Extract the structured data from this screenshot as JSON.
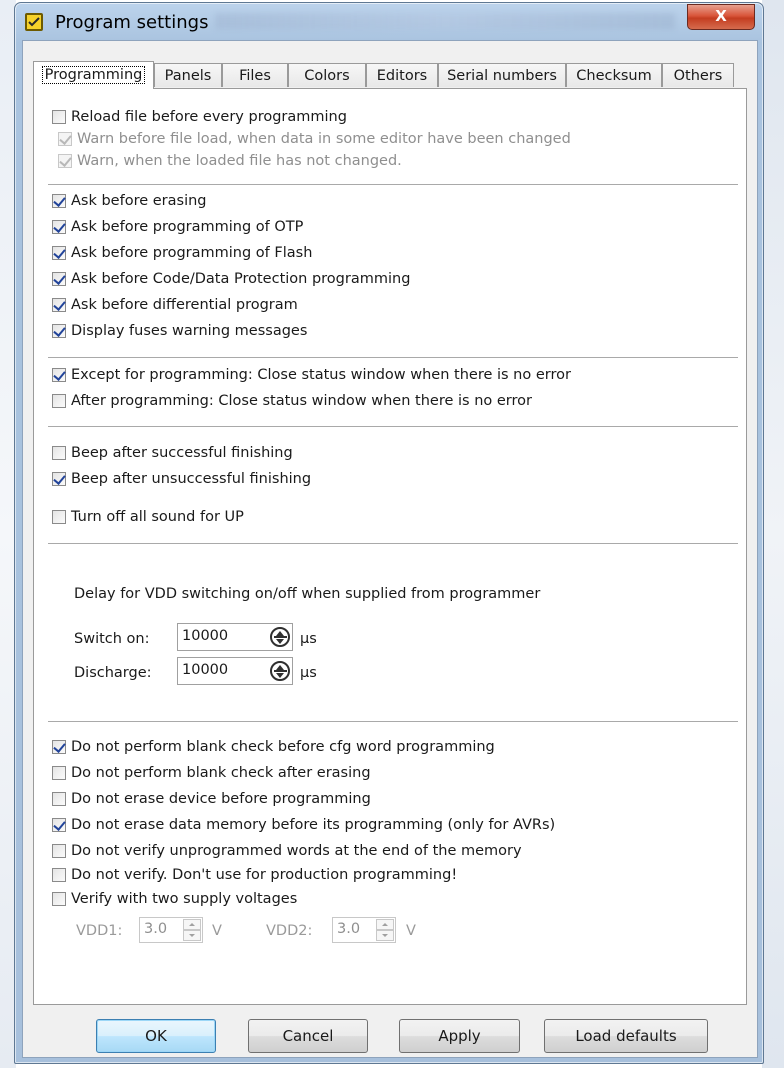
{
  "window": {
    "title": "Program settings",
    "close": "X"
  },
  "tabs": [
    "Programming",
    "Panels",
    "Files",
    "Colors",
    "Editors",
    "Serial numbers",
    "Checksum",
    "Others"
  ],
  "programming": {
    "reload": {
      "label": "Reload file before every programming",
      "checked": false
    },
    "warn_changed": {
      "label": "Warn before file load, when data in some editor have been changed",
      "checked": true,
      "disabled": true
    },
    "warn_unchanged": {
      "label": "Warn, when the loaded file has not changed.",
      "checked": true,
      "disabled": true
    },
    "ask": [
      {
        "label": "Ask before erasing",
        "checked": true
      },
      {
        "label": "Ask before programming of OTP",
        "checked": true
      },
      {
        "label": "Ask before programming of Flash",
        "checked": true
      },
      {
        "label": "Ask before Code/Data Protection programming",
        "checked": true
      },
      {
        "label": "Ask before differential program",
        "checked": true
      },
      {
        "label": "Display fuses warning messages",
        "checked": true
      }
    ],
    "status": [
      {
        "label": "Except for programming: Close status window when there is no error",
        "checked": true
      },
      {
        "label": "After programming: Close status window when there is no error",
        "checked": false
      }
    ],
    "sound": [
      {
        "label": "Beep after successful finishing",
        "checked": false
      },
      {
        "label": "Beep after unsuccessful finishing",
        "checked": true
      },
      {
        "label": "Turn off all sound for UP",
        "checked": false
      }
    ],
    "vdd": {
      "heading": "Delay for VDD switching on/off when supplied from programmer",
      "switch_on_label": "Switch on:",
      "switch_on_value": "10000",
      "discharge_label": "Discharge:",
      "discharge_value": "10000",
      "unit": "μs"
    },
    "verify": [
      {
        "label": "Do not perform blank check before cfg word programming",
        "checked": true
      },
      {
        "label": "Do not perform blank check after erasing",
        "checked": false
      },
      {
        "label": "Do not erase device before programming",
        "checked": false
      },
      {
        "label": "Do not erase data memory before its programming (only for AVRs)",
        "checked": true
      },
      {
        "label": "Do not verify unprogrammed words at the end of the memory",
        "checked": false
      },
      {
        "label": "Do not verify. Don't use for production programming!",
        "checked": false
      },
      {
        "label": "Verify with two supply voltages",
        "checked": false
      }
    ],
    "voltages": {
      "vdd1_label": "VDD1:",
      "vdd1_value": "3.0",
      "vdd2_label": "VDD2:",
      "vdd2_value": "3.0",
      "unit": "V"
    }
  },
  "buttons": {
    "ok": "OK",
    "cancel": "Cancel",
    "apply": "Apply",
    "defaults": "Load defaults"
  }
}
